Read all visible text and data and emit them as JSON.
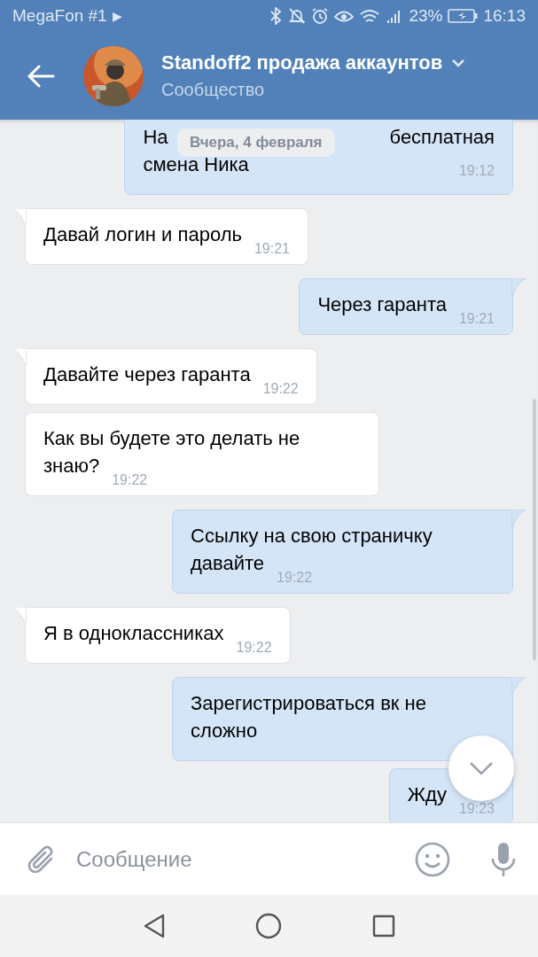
{
  "status_bar": {
    "carrier": "MegaFon #1",
    "carrier_arrow": "▶",
    "battery": "23%",
    "time": "16:13"
  },
  "header": {
    "title": "Standoff2 продажа аккаунтов",
    "subtitle": "Сообщество"
  },
  "date_pill": "Вчера, 4 февраля",
  "messages": [
    {
      "kind": "covered",
      "outgoing": true,
      "tail": false,
      "parts": [
        "На",
        "бесплатная",
        "смена Ника"
      ],
      "time": "19:12"
    },
    {
      "kind": "text",
      "outgoing": false,
      "tail": true,
      "text": "Давай логин и пароль",
      "time": "19:21"
    },
    {
      "kind": "text",
      "outgoing": true,
      "tail": true,
      "text": "Через гаранта",
      "time": "19:21"
    },
    {
      "kind": "text",
      "outgoing": false,
      "tail": true,
      "text": "Давайте через гаранта",
      "time": "19:22"
    },
    {
      "kind": "text",
      "outgoing": false,
      "tail": false,
      "text": "Как вы будете это делать не знаю?",
      "time": "19:22"
    },
    {
      "kind": "text",
      "outgoing": true,
      "tail": true,
      "text": "Ссылку на свою страничку давайте",
      "time": "19:22"
    },
    {
      "kind": "text",
      "outgoing": false,
      "tail": true,
      "text": "Я в одноклассниках",
      "time": "19:22"
    },
    {
      "kind": "text",
      "outgoing": true,
      "tail": true,
      "text": "Зарегистрироваться вк не сложно"
    },
    {
      "kind": "text",
      "outgoing": true,
      "tail": false,
      "text": "Жду",
      "time": "19:23"
    }
  ],
  "composer": {
    "placeholder": "Сообщение"
  }
}
